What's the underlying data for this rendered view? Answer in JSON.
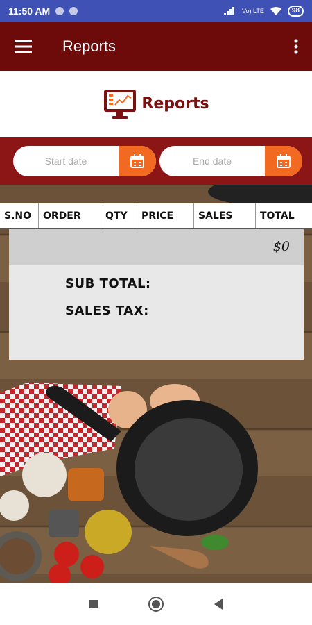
{
  "status_bar": {
    "time": "11:50 AM",
    "network": "Vo) LTE",
    "battery": "98"
  },
  "app_bar": {
    "title": "Reports"
  },
  "banner": {
    "title": "Reports"
  },
  "date_filter": {
    "start_placeholder": "Start date",
    "end_placeholder": "End date"
  },
  "table": {
    "columns": [
      "S.NO",
      "ORDER",
      "QTY",
      "PRICE",
      "SALES",
      "TOTAL"
    ]
  },
  "summary": {
    "total_value": "$0",
    "sub_total_label": "SUB TOTAL:",
    "sales_tax_label": "SALES TAX:"
  },
  "colors": {
    "app_bar": "#6d0a0a",
    "date_row": "#8c1515",
    "accent": "#f26a22",
    "status_bar": "#3f51b5"
  }
}
